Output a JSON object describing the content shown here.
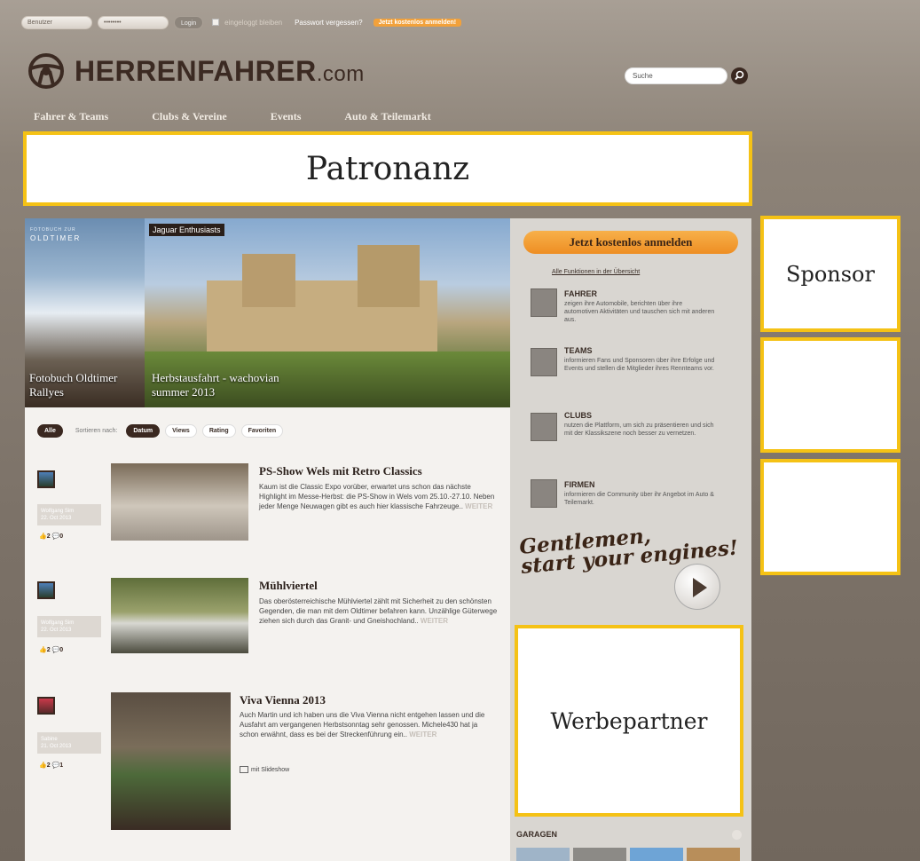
{
  "topbar": {
    "user_placeholder": "Benutzer",
    "pass_placeholder": "••••••••",
    "login": "Login",
    "remember": "eingeloggt bleiben",
    "forgot": "Passwort vergessen?",
    "register": "Jetzt kostenlos anmelden!"
  },
  "logo": {
    "main": "HERRENFAHRER",
    "suffix": ".com"
  },
  "search": {
    "placeholder": "Suche"
  },
  "nav": [
    "Fahrer & Teams",
    "Clubs & Vereine",
    "Events",
    "Auto & Teilemarkt"
  ],
  "placeholders": {
    "patronanz": "Patronanz",
    "sponsor": "Sponsor",
    "werbepartner": "Werbepartner"
  },
  "hero": {
    "left_small": "FOTOBUCH ZUR",
    "left_title": "OLDTIMER",
    "left_caption": "Fotobuch Oldtimer Rallyes",
    "tag": "Jaguar Enthusiasts",
    "right_caption": "Herbstausfahrt - wachovian summer 2013"
  },
  "filters": {
    "all": "Alle",
    "sort_label": "Sortieren nach:",
    "options": [
      "Datum",
      "Views",
      "Rating",
      "Favoriten"
    ]
  },
  "articles": [
    {
      "title": "PS-Show Wels mit Retro Classics",
      "text": "Kaum ist die Classic Expo vorüber, erwartet uns schon das nächste Highlight im Messe-Herbst: die PS-Show in Wels vom 25.10.-27.10. Neben jeder Menge Neuwagen gibt es auch hier klassische Fahrzeuge..",
      "more": "WEITER",
      "author": "Wolfgang Sim",
      "date": "22. Oct 2013",
      "likes": "2",
      "comments": "0"
    },
    {
      "title": "Mühlviertel",
      "text": "Das oberösterreichische Mühlviertel zählt mit Sicherheit zu den schönsten Gegenden, die man mit dem Oldtimer befahren kann. Unzählige Güterwege ziehen sich durch das Granit- und Gneishochland..",
      "more": "WEITER",
      "author": "Wolfgang Sim",
      "date": "22. Oct 2013",
      "likes": "2",
      "comments": "0"
    },
    {
      "title": "Viva Vienna 2013",
      "text": "Auch Martin und ich haben uns die Viva Vienna nicht entgehen lassen und die Ausfahrt am vergangenen Herbstsonntag sehr genossen. Michele430 hat ja schon erwähnt, dass es bei der Streckenführung ein..",
      "more": "WEITER",
      "author": "Sabine",
      "date": "21. Oct 2013",
      "likes": "2",
      "comments": "1",
      "slideshow": "mit Slideshow"
    }
  ],
  "sidebar": {
    "signup": "Jetzt kostenlos anmelden",
    "all_functions": "Alle Funktionen in der Übersicht",
    "features": [
      {
        "title": "FAHRER",
        "text": "zeigen ihre Automobile, berichten über ihre automotiven Aktivitäten und tauschen sich mit anderen aus."
      },
      {
        "title": "TEAMS",
        "text": "informieren Fans und Sponsoren über ihre Erfolge und Events und stellen die Mitglieder ihres Rennteams vor."
      },
      {
        "title": "CLUBS",
        "text": "nutzen die Plattform, um sich zu präsentieren und sich mit der Klassikszene noch besser zu vernetzen."
      },
      {
        "title": "FIRMEN",
        "text": "informieren die Community über ihr Angebot im Auto & Teilemarkt."
      }
    ],
    "tagline1": "Gentlemen,",
    "tagline2": "start your engines!",
    "garagen": "GARAGEN"
  },
  "colors": {
    "accent_orange": "#f2a13b",
    "placeholder_border": "#f5c215",
    "brand_dark": "#3a2820"
  }
}
